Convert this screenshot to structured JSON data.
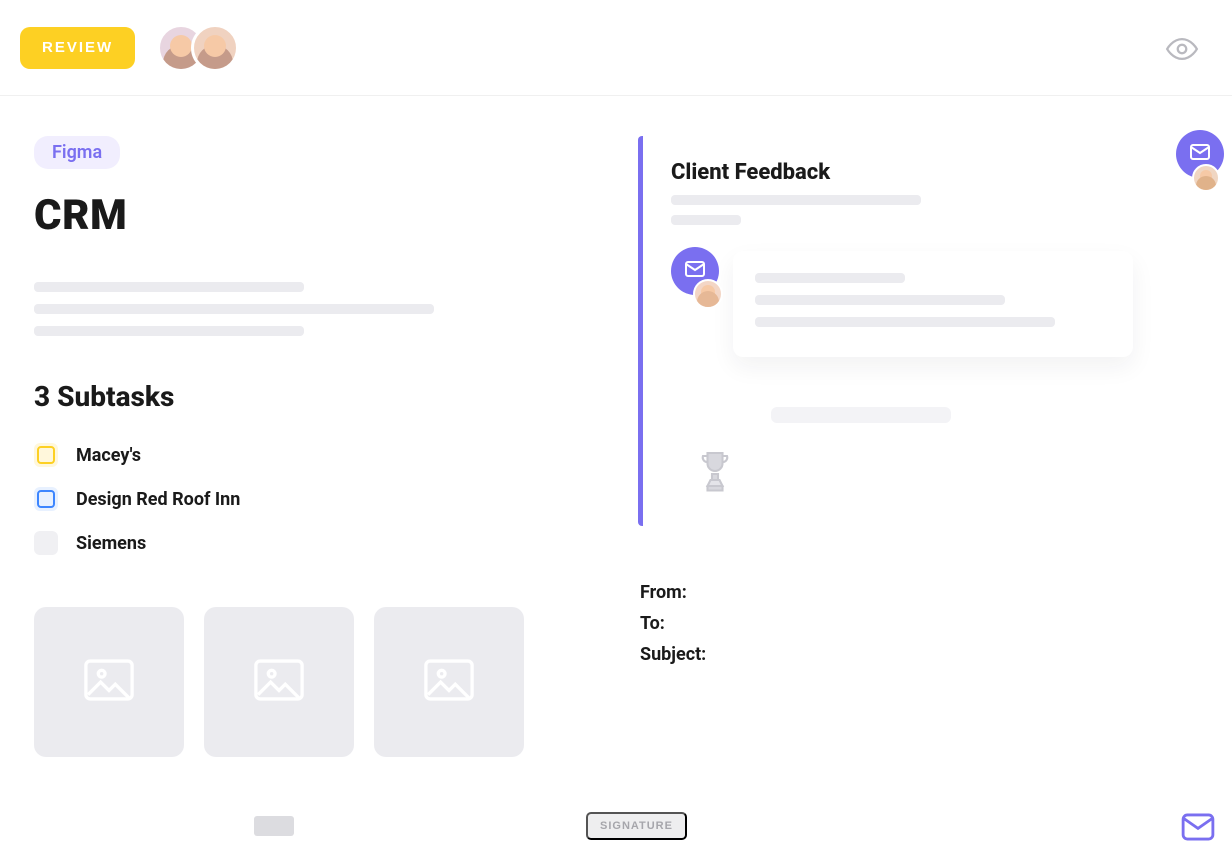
{
  "colors": {
    "accent_yellow": "#fdd023",
    "accent_purple": "#7a6ff0",
    "accent_blue": "#3d86ff",
    "placeholder_gray": "#ebebef"
  },
  "topbar": {
    "review_button_label": "REVIEW"
  },
  "left": {
    "tag_label": "Figma",
    "title": "CRM",
    "subtasks_heading": "3 Subtasks",
    "subtasks": [
      {
        "label": "Macey's",
        "status": "yellow"
      },
      {
        "label": "Design Red Roof Inn",
        "status": "blue"
      },
      {
        "label": "Siemens",
        "status": "plain"
      }
    ]
  },
  "feedback": {
    "title": "Client Feedback"
  },
  "compose": {
    "from_label": "From:",
    "to_label": "To:",
    "subject_label": "Subject:"
  },
  "bottom": {
    "signature_label": "SIGNATURE"
  },
  "icons": {
    "eye": "eye-icon",
    "mail": "mail-icon",
    "image": "image-icon",
    "trophy": "trophy-icon"
  }
}
